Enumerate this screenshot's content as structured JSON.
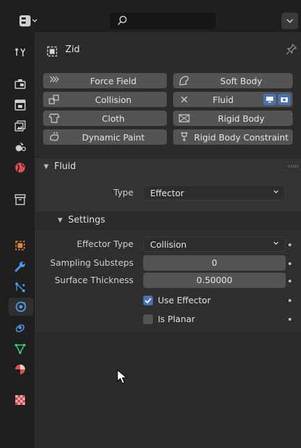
{
  "header": {
    "object_name": "Zid"
  },
  "physics_buttons": {
    "force_field": "Force Field",
    "soft_body": "Soft Body",
    "collision": "Collision",
    "fluid": "Fluid",
    "cloth": "Cloth",
    "rigid_body": "Rigid Body",
    "dynamic_paint": "Dynamic Paint",
    "rigid_body_constraint": "Rigid Body Constraint"
  },
  "fluid_panel": {
    "title": "Fluid",
    "type_label": "Type",
    "type_value": "Effector"
  },
  "settings_panel": {
    "title": "Settings",
    "effector_type_label": "Effector Type",
    "effector_type_value": "Collision",
    "sampling_label": "Sampling Substeps",
    "sampling_value": "0",
    "thickness_label": "Surface Thickness",
    "thickness_value": "0.50000",
    "use_effector_label": "Use Effector",
    "use_effector_checked": true,
    "is_planar_label": "Is Planar",
    "is_planar_checked": false
  },
  "colors": {
    "accent": "#4772b3",
    "background": "#2b2b2b",
    "button": "#545454"
  },
  "tab_icons": [
    "tool-icon",
    "render-icon",
    "output-icon",
    "view-layer-icon",
    "scene-icon",
    "world-icon",
    "collection-icon",
    "object-icon",
    "modifier-icon",
    "particles-icon",
    "physics-icon",
    "constraints-icon",
    "data-icon",
    "material-icon",
    "texture-icon"
  ]
}
